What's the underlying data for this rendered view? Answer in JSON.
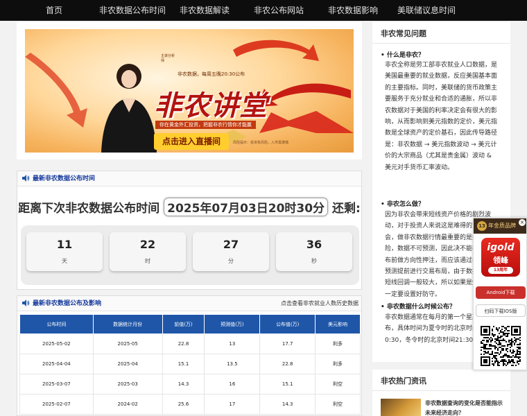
{
  "nav": {
    "items": [
      "首页",
      "非农数据公布时间",
      "非农数据解读",
      "非农公布网站",
      "非农数据影响",
      "美联储议息时间"
    ]
  },
  "banner": {
    "title": "非农讲堂",
    "top_text": "非农数据，每周五晚20:30公布",
    "sub_text": "你在黄金外汇投资，把握非农行情你才能赢",
    "cta": "点击进入直播间",
    "small_text": "风险提示：投资有风险，入市需谨慎",
    "host_text": "主讲分析师"
  },
  "countdown": {
    "section_title": "最新非农数据公布时间",
    "prefix": "距离下次非农数据公布时间",
    "date": "2025年07月03日20时30分",
    "suffix": "还剩:",
    "cells": [
      {
        "value": "11",
        "unit": "天"
      },
      {
        "value": "22",
        "unit": "时"
      },
      {
        "value": "27",
        "unit": "分"
      },
      {
        "value": "36",
        "unit": "秒"
      }
    ]
  },
  "table": {
    "section_title": "最新非农数据公布及影响",
    "link": "点击查看非农就业人数历史数据",
    "headers": [
      "公布时间",
      "数据统计月份",
      "前值(万)",
      "预测值(万)",
      "公布值(万)",
      "美元影响"
    ],
    "rows": [
      [
        "2025-05-02",
        "2025-05",
        "22.8",
        "13",
        "17.7",
        "利多"
      ],
      [
        "2025-04-04",
        "2025-04",
        "15.1",
        "13.5",
        "22.8",
        "利多"
      ],
      [
        "2025-03-07",
        "2025-03",
        "14.3",
        "16",
        "15.1",
        "利空"
      ],
      [
        "2025-02-07",
        "2024-02",
        "25.6",
        "17",
        "14.3",
        "利空"
      ]
    ]
  },
  "faq": {
    "title": "非农常见问题",
    "items": [
      {
        "q": "• 什么是非农？",
        "a": "非农全称是劳工部非农就业人口数据，是美国最重要的就业数据，反应美国基本面的主要指标。同时，美联储的货币政策主要服务于充分就业和合适的通胀，所以非农数据对于美国的利率决定会有很大的影响，从而影响到美元指数的定价，美元指数是全球资产的定价基石，因此传导路径是：非农数据 → 美元指数波动 → 美元计价的大宗商品（尤其是贵金属）波动 & 美元对手货币汇率波动。"
      },
      {
        "q": "• 非农怎么做？",
        "a": "因为非农会带来短线资产价格的剧烈波动，对于投资人来说这是难得的交易机会，做非农数据行情最重要的是控制风险，数据不可预测，因此决不能在数据公布前做方向性押注，而应该通过各种数据预测提前进行交易布局，由于数据发布后短线回调一般较大，所以如果是短线交易一定要设置好防守。"
      },
      {
        "q": "• 非农数据什么时候公布？",
        "a": "非农数据通常在每月的第一个星期五公布，具体时间为夏令时的北京时间晚上20:30，冬令时的北京时间21:30。"
      }
    ]
  },
  "hot": {
    "title": "非农热门资讯",
    "items": [
      {
        "text": "非农数据查询的变化是否能指示未来经济走向？"
      }
    ]
  },
  "float_ad": {
    "badge": "13",
    "header": "年金质品牌",
    "close": "×",
    "app_name": "igold",
    "app_cn": "领峰",
    "app_tag": "13周年",
    "android": "Android下载",
    "ios": "扫码下载IOS版"
  },
  "colors": {
    "nav_bg": "#0d0d0d",
    "accent_blue": "#1f56a8",
    "title_blue": "#15399d",
    "banner_red": "#b4130f",
    "ad_red": "#c9302c"
  }
}
